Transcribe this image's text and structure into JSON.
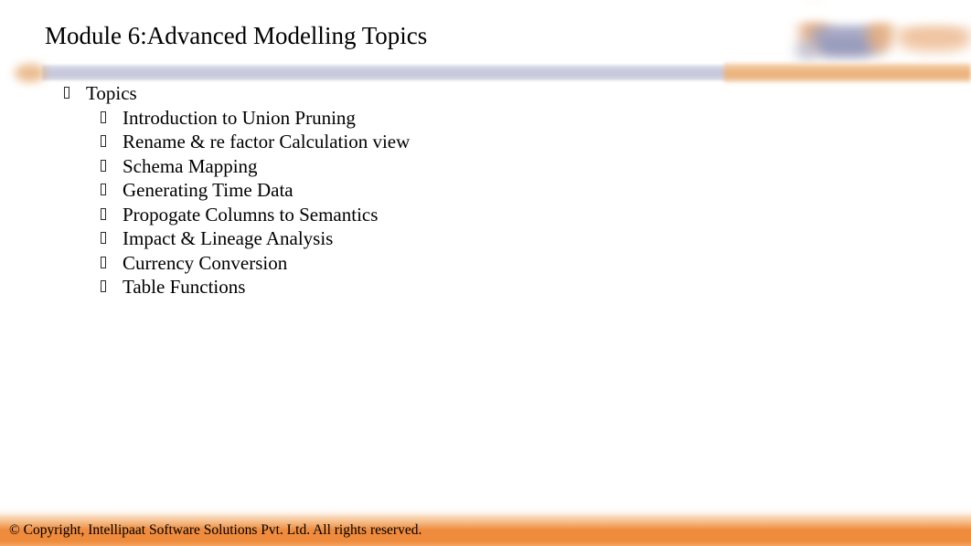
{
  "slide": {
    "title": "Module 6:Advanced Modelling Topics",
    "bullet_glyph_name": "tofu-box-bullet",
    "colors": {
      "divider_lavender": "#c6c6da",
      "divider_orange": "#e9b07a",
      "footer_orange": "#ef8b3c",
      "deco_blue": "#9ea1c0",
      "deco_tan": "#e4a878",
      "text": "#000000",
      "background": "#ffffff"
    },
    "bullets": [
      {
        "level": 1,
        "label": "Topics"
      },
      {
        "level": 2,
        "label": "Introduction to Union Pruning"
      },
      {
        "level": 2,
        "label": "Rename & re factor Calculation view"
      },
      {
        "level": 2,
        "label": "Schema Mapping"
      },
      {
        "level": 2,
        "label": "Generating Time Data"
      },
      {
        "level": 2,
        "label": "Propogate Columns to Semantics"
      },
      {
        "level": 2,
        "label": "Impact & Lineage Analysis"
      },
      {
        "level": 2,
        "label": "Currency Conversion"
      },
      {
        "level": 2,
        "label": "Table Functions"
      }
    ],
    "footer": {
      "copyright": "© Copyright, Intellipaat Software Solutions Pvt. Ltd. All rights reserved."
    }
  }
}
